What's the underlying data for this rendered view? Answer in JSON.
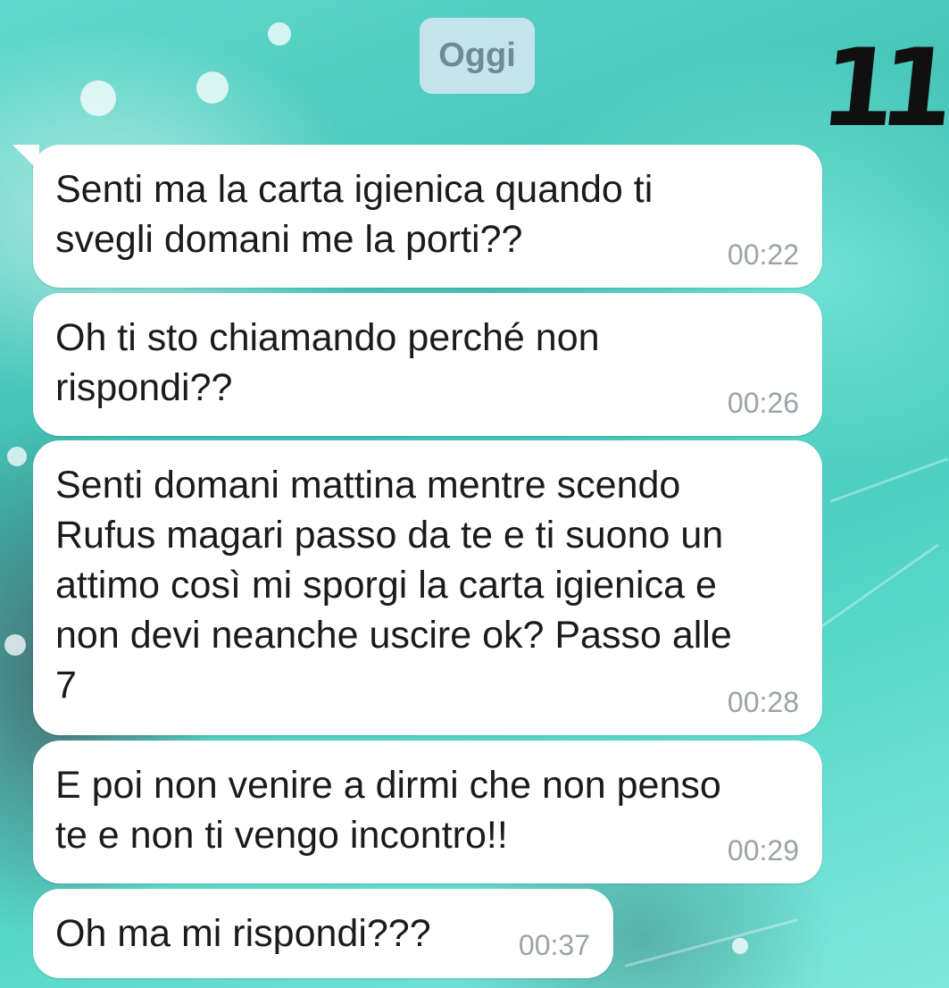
{
  "date_separator": "Oggi",
  "corner_number": "11",
  "messages": [
    {
      "text": "Senti ma la carta igienica quando ti\nsvegli domani me la porti??",
      "time": "00:22"
    },
    {
      "text": "Oh ti sto chiamando perché non\nrispondi??",
      "time": "00:26"
    },
    {
      "text": "Senti domani mattina mentre scendo\nRufus magari passo da te e ti suono un\nattimo così mi sporgi la carta igienica e\nnon devi neanche uscire ok? Passo alle\n7",
      "time": "00:28"
    },
    {
      "text": "E poi non venire a dirmi che non penso\nte e non ti vengo incontro!!",
      "time": "00:29"
    },
    {
      "text": "Oh ma mi rispondi???",
      "time": "00:37"
    }
  ],
  "colors": {
    "bubble": "#ffffff",
    "date_pill": "#c5e3ec",
    "background_accent": "#5fd9cc"
  }
}
